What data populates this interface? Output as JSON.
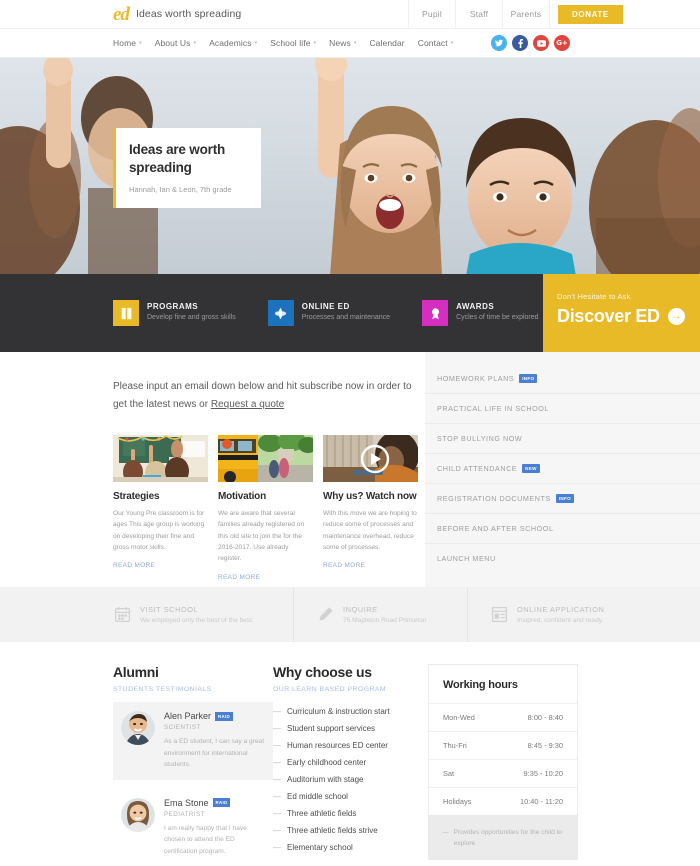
{
  "topbar": {
    "logo_mark": "ed",
    "logo_text": "Ideas worth spreading",
    "links": [
      {
        "label": "Pupil"
      },
      {
        "label": "Staff"
      },
      {
        "label": "Parents"
      }
    ],
    "donate_label": "DONATE",
    "donate_color": "#e9ba27"
  },
  "nav": {
    "items": [
      {
        "label": "Home",
        "caret": "▾"
      },
      {
        "label": "About Us",
        "caret": "▾"
      },
      {
        "label": "Academics",
        "caret": "▾"
      },
      {
        "label": "School life",
        "caret": "▾"
      },
      {
        "label": "News",
        "caret": "▾"
      },
      {
        "label": "Calendar",
        "caret": ""
      },
      {
        "label": "Contact",
        "caret": "▾"
      }
    ],
    "socials": [
      {
        "name": "twitter-icon",
        "glyph": "t",
        "color": "#46b4e8"
      },
      {
        "name": "facebook-icon",
        "glyph": "f",
        "color": "#3b5b9c"
      },
      {
        "name": "youtube-icon",
        "glyph": "▶",
        "color": "#e0453d"
      },
      {
        "name": "googleplus-icon",
        "glyph": "G+",
        "color": "#e0453d"
      }
    ]
  },
  "hero": {
    "title": "Ideas are worth spreading",
    "caption": "Hannah, Ian & Leon, 7th grade"
  },
  "features": [
    {
      "title": "PROGRAMS",
      "sub": "Develop fine and gross skills",
      "icon": "book-icon",
      "glyph": "◫",
      "color": "#e9ba27"
    },
    {
      "title": "ONLINE ED",
      "sub": "Processes and maintenance",
      "icon": "globe-icon",
      "glyph": "✹",
      "color": "#1d72bd"
    },
    {
      "title": "AWARDS",
      "sub": "Cycles of time be explored",
      "icon": "medal-icon",
      "glyph": "❁",
      "color": "#d62ec0"
    }
  ],
  "discover": {
    "sub": "Don't Hesitate to Ask",
    "main": "Discover ED",
    "arrow": "→"
  },
  "intro": {
    "line1": "Please input an email down below and hit subscribe now in order to",
    "line2_prefix": "get the latest news or ",
    "link": "Request a quote"
  },
  "cards": [
    {
      "title": "Strategies",
      "body": "Our Young Pre classroom is for ages This age group is working on developing their fine and gross motor skills.",
      "readmore": "READ MORE",
      "thumb": "classroom-photo"
    },
    {
      "title": "Motivation",
      "body": "We are aware that several families already registered on this old site to join the for the 2016-2017. Use already register.",
      "readmore": "READ MORE",
      "thumb": "school-bus-photo"
    },
    {
      "title": "Why us? Watch now",
      "body": "With this move we are hoping to reduce some of processes and maintenance overhead, reduce some of processes.",
      "readmore": "READ MORE",
      "thumb": "video-photo"
    }
  ],
  "sidebar": {
    "links": [
      {
        "label": "HOMEWORK PLANS",
        "badge": "INFO"
      },
      {
        "label": "PRACTICAL LIFE IN SCHOOL",
        "badge": ""
      },
      {
        "label": "STOP BULLYING NOW",
        "badge": ""
      },
      {
        "label": "CHILD ATTENDANCE",
        "badge": "NEW"
      },
      {
        "label": "REGISTRATION DOCUMENTS",
        "badge": "INFO"
      },
      {
        "label": "BEFORE AND AFTER SCHOOL",
        "badge": ""
      },
      {
        "label": "LAUNCH MENU",
        "badge": ""
      }
    ]
  },
  "infostrip": [
    {
      "title": "VISIT SCHOOL",
      "sub": "We employed only the best of the best",
      "icon": "calendar-icon",
      "glyph": "☷"
    },
    {
      "title": "INQUIRE",
      "sub": "75 Mapleton Road Princeton",
      "icon": "pencil-icon",
      "glyph": "✎"
    },
    {
      "title": "ONLINE APPLICATION",
      "sub": "Insipred, confident and ready.",
      "icon": "form-icon",
      "glyph": "▤"
    }
  ],
  "alumni": {
    "heading": "Alumni",
    "subheading": "STUDENTS TESTIMONIALS",
    "testimonials": [
      {
        "name": "Alen Parker",
        "badge": "RAID",
        "role": "SCIENTIST",
        "body": "As a ED student, I can say a great environment for international students.",
        "avatar": "man-photo"
      },
      {
        "name": "Ema Stone",
        "badge": "RAID",
        "role": "PEDIATRIST",
        "body": "I am really happy that I have chosen to attend the ED certification program.",
        "avatar": "woman-photo"
      }
    ]
  },
  "why": {
    "heading": "Why choose us",
    "subheading": "OUR LEARN BASED PROGRAM",
    "items": [
      "Curriculum & instruction start",
      "Student support services",
      "Human resources ED center",
      "Early childhood center",
      "Auditorium with stage",
      "Ed middle school",
      "Three athletic fields",
      "Three athletic fields strive",
      "Elementary school"
    ]
  },
  "hours": {
    "heading": "Working hours",
    "rows": [
      {
        "day": "Mon-Wed",
        "time": "8:00 - 8:40"
      },
      {
        "day": "Thu-Fri",
        "time": "8:45 - 9:30"
      },
      {
        "day": "Sat",
        "time": "9:35 - 10:20"
      },
      {
        "day": "Holidays",
        "time": "10:40 - 11:20"
      }
    ],
    "note": "Provides opportunities for the child to explore"
  }
}
